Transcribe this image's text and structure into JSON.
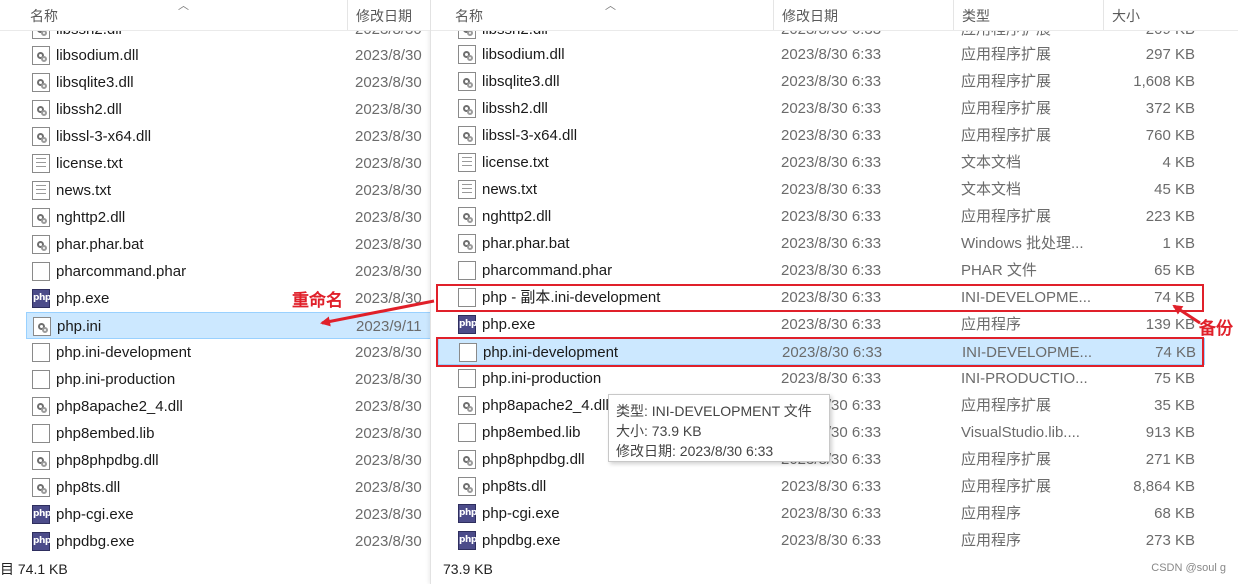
{
  "left": {
    "headers": {
      "name": "名称",
      "date": "修改日期"
    },
    "clipped_top": {
      "name": "libssh2.dll",
      "date": "2023/8/30"
    },
    "rows": [
      {
        "name": "libsodium.dll",
        "date": "2023/8/30",
        "icon": "dll-gear-icon"
      },
      {
        "name": "libsqlite3.dll",
        "date": "2023/8/30",
        "icon": "dll-gear-icon"
      },
      {
        "name": "libssh2.dll",
        "date": "2023/8/30",
        "icon": "dll-gear-icon"
      },
      {
        "name": "libssl-3-x64.dll",
        "date": "2023/8/30",
        "icon": "dll-gear-icon"
      },
      {
        "name": "license.txt",
        "date": "2023/8/30",
        "icon": "text-file-icon"
      },
      {
        "name": "news.txt",
        "date": "2023/8/30",
        "icon": "text-file-icon"
      },
      {
        "name": "nghttp2.dll",
        "date": "2023/8/30",
        "icon": "dll-gear-icon"
      },
      {
        "name": "phar.phar.bat",
        "date": "2023/8/30",
        "icon": "batch-gear-icon"
      },
      {
        "name": "pharcommand.phar",
        "date": "2023/8/30",
        "icon": "blank-file-icon"
      },
      {
        "name": "php.exe",
        "date": "2023/8/30",
        "icon": "php-exe-icon"
      },
      {
        "name": "php.ini",
        "date": "2023/9/11",
        "icon": "ini-settings-icon",
        "selected": true
      },
      {
        "name": "php.ini-development",
        "date": "2023/8/30",
        "icon": "blank-file-icon"
      },
      {
        "name": "php.ini-production",
        "date": "2023/8/30",
        "icon": "blank-file-icon"
      },
      {
        "name": "php8apache2_4.dll",
        "date": "2023/8/30",
        "icon": "dll-gear-icon"
      },
      {
        "name": "php8embed.lib",
        "date": "2023/8/30",
        "icon": "blank-file-icon"
      },
      {
        "name": "php8phpdbg.dll",
        "date": "2023/8/30",
        "icon": "dll-gear-icon"
      },
      {
        "name": "php8ts.dll",
        "date": "2023/8/30",
        "icon": "dll-gear-icon"
      },
      {
        "name": "php-cgi.exe",
        "date": "2023/8/30",
        "icon": "php-exe-icon"
      },
      {
        "name": "phpdbg.exe",
        "date": "2023/8/30",
        "icon": "php-exe-icon"
      }
    ],
    "status": "目 74.1 KB"
  },
  "right": {
    "headers": {
      "name": "名称",
      "date": "修改日期",
      "type": "类型",
      "size": "大小"
    },
    "clipped_top": {
      "name": "libssh2.dll",
      "date": "2023/8/30 6:33",
      "type": "应用程序扩展",
      "size": "209 KB"
    },
    "rows": [
      {
        "name": "libsodium.dll",
        "date": "2023/8/30 6:33",
        "type": "应用程序扩展",
        "size": "297 KB",
        "icon": "dll-gear-icon"
      },
      {
        "name": "libsqlite3.dll",
        "date": "2023/8/30 6:33",
        "type": "应用程序扩展",
        "size": "1,608 KB",
        "icon": "dll-gear-icon"
      },
      {
        "name": "libssh2.dll",
        "date": "2023/8/30 6:33",
        "type": "应用程序扩展",
        "size": "372 KB",
        "icon": "dll-gear-icon"
      },
      {
        "name": "libssl-3-x64.dll",
        "date": "2023/8/30 6:33",
        "type": "应用程序扩展",
        "size": "760 KB",
        "icon": "dll-gear-icon"
      },
      {
        "name": "license.txt",
        "date": "2023/8/30 6:33",
        "type": "文本文档",
        "size": "4 KB",
        "icon": "text-file-icon"
      },
      {
        "name": "news.txt",
        "date": "2023/8/30 6:33",
        "type": "文本文档",
        "size": "45 KB",
        "icon": "text-file-icon"
      },
      {
        "name": "nghttp2.dll",
        "date": "2023/8/30 6:33",
        "type": "应用程序扩展",
        "size": "223 KB",
        "icon": "dll-gear-icon"
      },
      {
        "name": "phar.phar.bat",
        "date": "2023/8/30 6:33",
        "type": "Windows 批处理...",
        "size": "1 KB",
        "icon": "batch-gear-icon"
      },
      {
        "name": "pharcommand.phar",
        "date": "2023/8/30 6:33",
        "type": "PHAR 文件",
        "size": "65 KB",
        "icon": "blank-file-icon"
      },
      {
        "name": "php - 副本.ini-development",
        "date": "2023/8/30 6:33",
        "type": "INI-DEVELOPME...",
        "size": "74 KB",
        "icon": "blank-file-icon"
      },
      {
        "name": "php.exe",
        "date": "2023/8/30 6:33",
        "type": "应用程序",
        "size": "139 KB",
        "icon": "php-exe-icon"
      },
      {
        "name": "php.ini-development",
        "date": "2023/8/30 6:33",
        "type": "INI-DEVELOPME...",
        "size": "74 KB",
        "icon": "blank-file-icon",
        "selected": true
      },
      {
        "name": "php.ini-production",
        "date": "2023/8/30 6:33",
        "type": "INI-PRODUCTIO...",
        "size": "75 KB",
        "icon": "blank-file-icon"
      },
      {
        "name": "php8apache2_4.dll",
        "date": "2023/8/30 6:33",
        "type": "应用程序扩展",
        "size": "35 KB",
        "icon": "dll-gear-icon"
      },
      {
        "name": "php8embed.lib",
        "date": "2023/8/30 6:33",
        "type": "VisualStudio.lib....",
        "size": "913 KB",
        "icon": "blank-file-icon"
      },
      {
        "name": "php8phpdbg.dll",
        "date": "2023/8/30 6:33",
        "type": "应用程序扩展",
        "size": "271 KB",
        "icon": "dll-gear-icon"
      },
      {
        "name": "php8ts.dll",
        "date": "2023/8/30 6:33",
        "type": "应用程序扩展",
        "size": "8,864 KB",
        "icon": "dll-gear-icon"
      },
      {
        "name": "php-cgi.exe",
        "date": "2023/8/30 6:33",
        "type": "应用程序",
        "size": "68 KB",
        "icon": "php-exe-icon"
      },
      {
        "name": "phpdbg.exe",
        "date": "2023/8/30 6:33",
        "type": "应用程序",
        "size": "273 KB",
        "icon": "php-exe-icon"
      }
    ],
    "status": "73.9 KB"
  },
  "tooltip": {
    "type_line": "类型: INI-DEVELOPMENT 文件",
    "size_line": "大小: 73.9 KB",
    "date_line": "修改日期: 2023/8/30 6:33"
  },
  "annotations": {
    "rename": "重命名",
    "backup": "备份"
  },
  "php_icon_text": "php",
  "watermark": "CSDN @soul g",
  "colors": {
    "selection": "#cce8ff",
    "annotation": "#e0202a"
  }
}
